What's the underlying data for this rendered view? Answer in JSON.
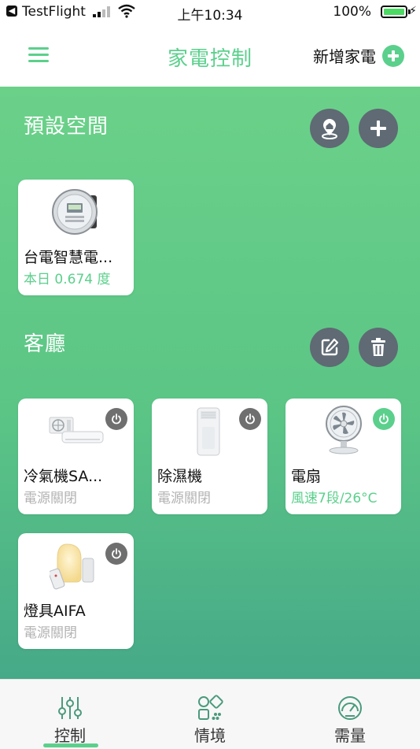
{
  "status_bar": {
    "back_app": "TestFlight",
    "time": "上午10:34",
    "battery_percent": "100%"
  },
  "nav": {
    "title": "家電控制",
    "add_device_label": "新增家電"
  },
  "sections": [
    {
      "title": "預設空間",
      "devices": [
        {
          "name": "台電智慧電...",
          "status": "本日 0.674 度",
          "status_on": true,
          "icon": "smart-meter-image"
        }
      ]
    },
    {
      "title": "客廳",
      "devices": [
        {
          "name": "冷氣機SA...",
          "status": "電源關閉",
          "power_on": false,
          "icon": "air-conditioner-image"
        },
        {
          "name": "除濕機",
          "status": "電源關閉",
          "power_on": false,
          "icon": "dehumidifier-image"
        },
        {
          "name": "電扇",
          "status": "風速7段/26°C",
          "power_on": true,
          "icon": "fan-image"
        },
        {
          "name": "燈具AIFA",
          "status": "電源關閉",
          "power_on": false,
          "icon": "lamp-image"
        }
      ]
    }
  ],
  "tabs": [
    {
      "label": "控制",
      "icon": "sliders-icon",
      "active": true
    },
    {
      "label": "情境",
      "icon": "scenes-icon",
      "active": false
    },
    {
      "label": "需量",
      "icon": "gauge-icon",
      "active": false
    }
  ],
  "colors": {
    "accent": "#5bd08c",
    "button_dark": "#5f6a74",
    "power_off": "#6f6f6f",
    "status_off": "#b3b3b3"
  }
}
